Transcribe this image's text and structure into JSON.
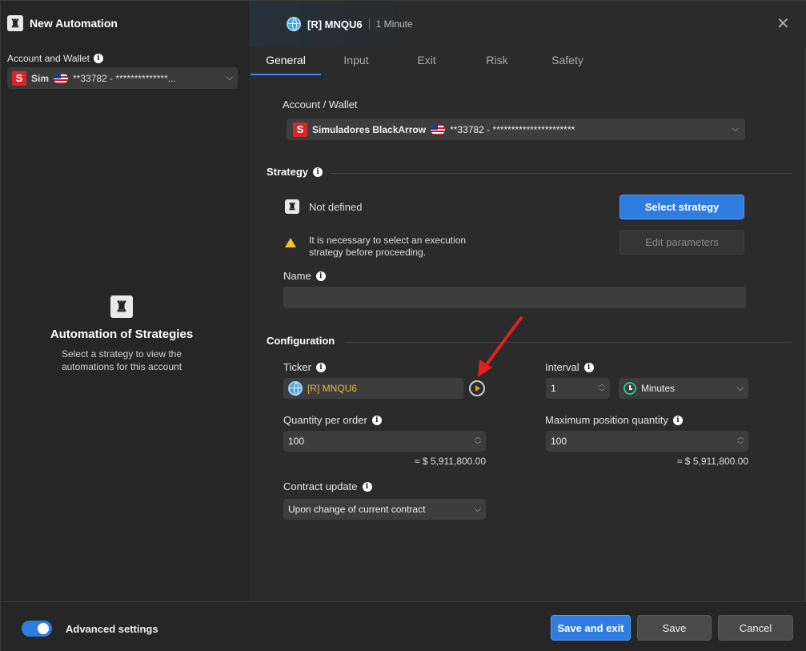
{
  "left": {
    "title": "New Automation",
    "account_label": "Account and Wallet",
    "account_badge": "S",
    "account_name": "Sim",
    "account_value": "**33782 - **************...",
    "empty_title": "Automation of Strategies",
    "empty_subtitle": "Select a strategy to view the automations for this account"
  },
  "header": {
    "ticker": "[R] MNQU6",
    "interval": "1 Minute"
  },
  "tabs": [
    {
      "label": "General",
      "active": true
    },
    {
      "label": "Input"
    },
    {
      "label": "Exit"
    },
    {
      "label": "Risk"
    },
    {
      "label": "Safety"
    }
  ],
  "general": {
    "wallet_label": "Account / Wallet",
    "wallet_badge": "S",
    "wallet_name": "Simuladores BlackArrow",
    "wallet_value": "**33782 - **********************",
    "strategy_section": "Strategy",
    "strategy_status": "Not defined",
    "select_strategy": "Select strategy",
    "edit_parameters": "Edit parameters",
    "warning": "It is necessary to select an execution strategy before proceeding.",
    "name_label": "Name",
    "name_value": "",
    "config_section": "Configuration",
    "ticker_label": "Ticker",
    "ticker_value": "[R] MNQU6",
    "interval_label": "Interval",
    "interval_value": "1",
    "interval_unit": "Minutes",
    "qty_label": "Quantity per order",
    "qty_value": "100",
    "qty_approx": "≈ $ 5,911,800.00",
    "maxpos_label": "Maximum position quantity",
    "maxpos_value": "100",
    "maxpos_approx": "≈ $ 5,911,800.00",
    "contract_label": "Contract update",
    "contract_value": "Upon change of current contract"
  },
  "footer": {
    "advanced_label": "Advanced settings",
    "advanced_on": true,
    "save_exit": "Save and exit",
    "save": "Save",
    "cancel": "Cancel"
  },
  "colors": {
    "accent": "#2f7de1",
    "ticker_text": "#e9b54a",
    "warning": "#f2c12e",
    "arrow": "#e02020"
  }
}
